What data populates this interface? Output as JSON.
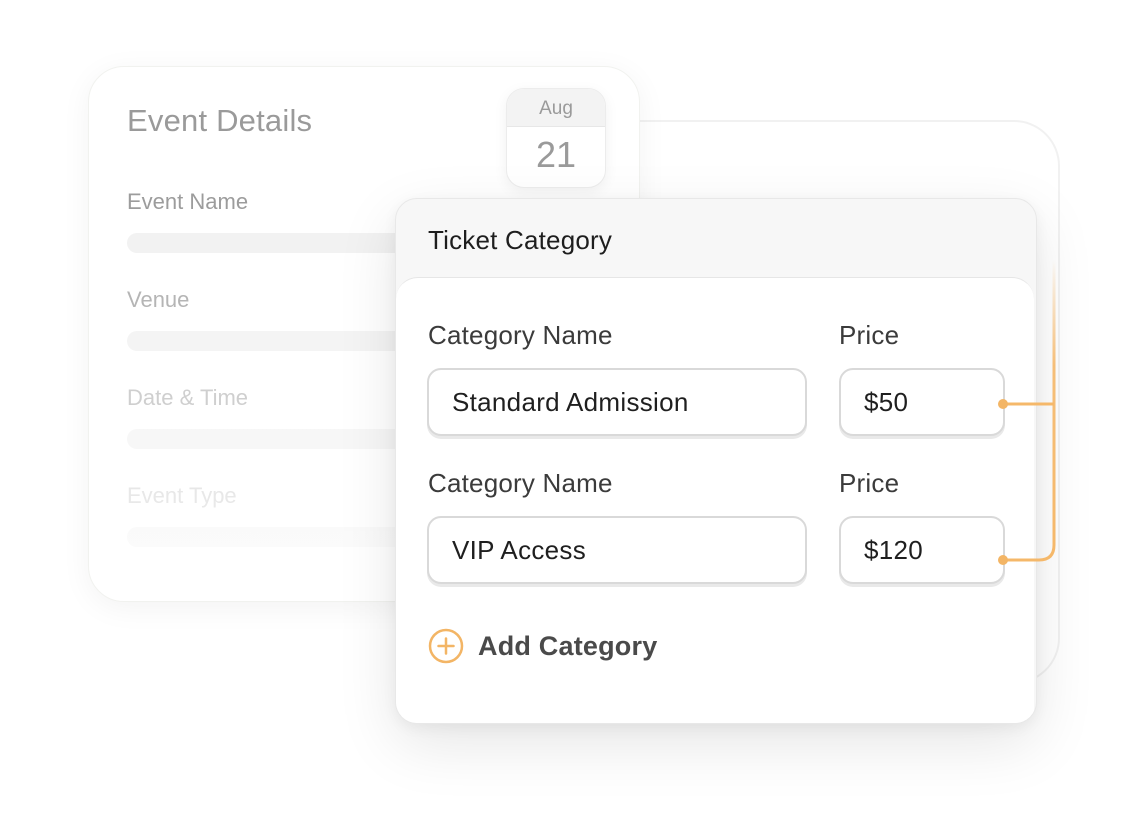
{
  "event_details": {
    "title": "Event Details",
    "fields": [
      {
        "label": "Event Name"
      },
      {
        "label": "Venue"
      },
      {
        "label": "Date & Time"
      },
      {
        "label": "Event Type"
      }
    ],
    "date": {
      "month": "Aug",
      "day": "21"
    }
  },
  "ticket_category": {
    "title": "Ticket Category",
    "rows": [
      {
        "name_label": "Category Name",
        "name_value": "Standard Admission",
        "price_label": "Price",
        "price_value": "$50"
      },
      {
        "name_label": "Category Name",
        "name_value": "VIP Access",
        "price_label": "Price",
        "price_value": "$120"
      }
    ],
    "add_label": "Add Category"
  },
  "colors": {
    "accent": "#f3b565",
    "connector": "#f5b86a"
  },
  "icons": {
    "add": "plus-circle-icon"
  }
}
